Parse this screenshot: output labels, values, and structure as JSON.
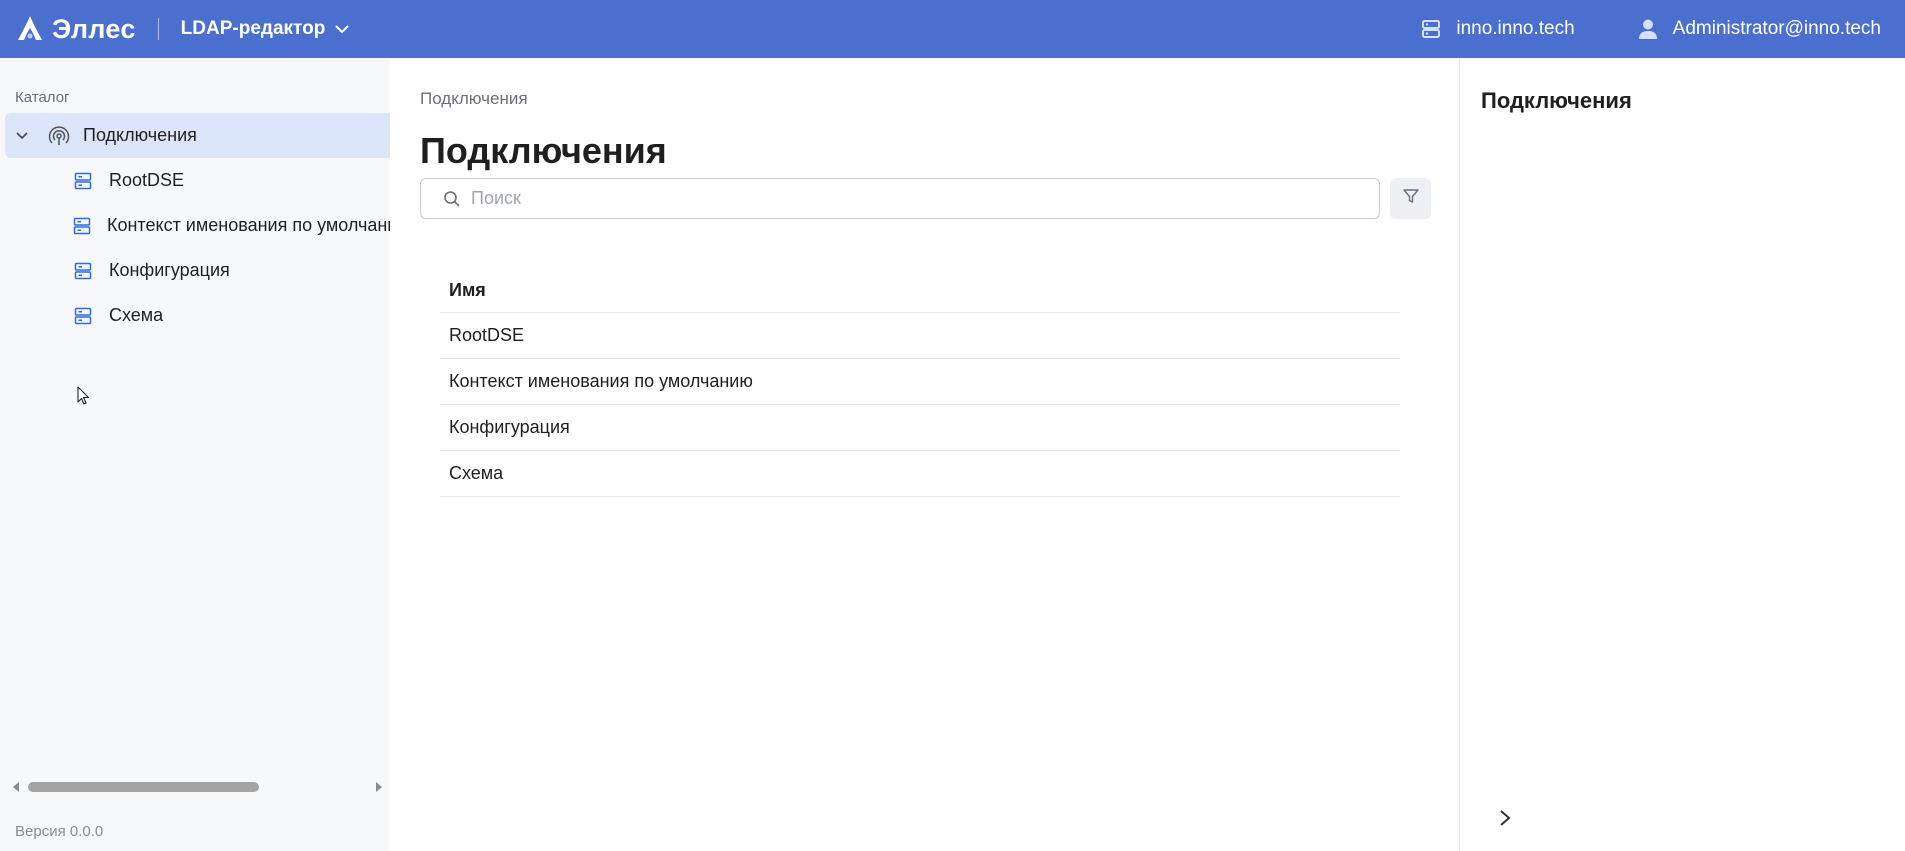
{
  "header": {
    "brand_name": "Эллес",
    "app_name": "LDAP-редактор",
    "server": "inno.inno.tech",
    "user": "Administrator@inno.tech",
    "icons": {
      "logo": "elles-logo",
      "server": "server-icon",
      "user": "user-icon",
      "app_dropdown": "chevron-down-icon"
    }
  },
  "sidebar": {
    "section_label": "Каталог",
    "root": {
      "label": "Подключения",
      "icon": "connection-icon",
      "expanded": true
    },
    "items": [
      {
        "label": "RootDSE",
        "icon": "server-icon"
      },
      {
        "label": "Контекст именования по умолчанию",
        "icon": "server-icon"
      },
      {
        "label": "Конфигурация",
        "icon": "server-icon"
      },
      {
        "label": "Схема",
        "icon": "server-icon"
      }
    ],
    "version": "Версия 0.0.0"
  },
  "main": {
    "breadcrumb": "Подключения",
    "title": "Подключения",
    "search": {
      "placeholder": "Поиск",
      "value": ""
    },
    "table": {
      "columns": [
        "Имя"
      ],
      "rows": [
        "RootDSE",
        "Контекст именования по умолчанию",
        "Конфигурация",
        "Схема"
      ]
    }
  },
  "details_panel": {
    "title": "Подключения"
  },
  "colors": {
    "header_bg": "#4b6fcf",
    "selected_row_bg": "#dbe6fb",
    "icon_blue": "#2f6bd8",
    "sidebar_bg": "#f7f8fa"
  }
}
